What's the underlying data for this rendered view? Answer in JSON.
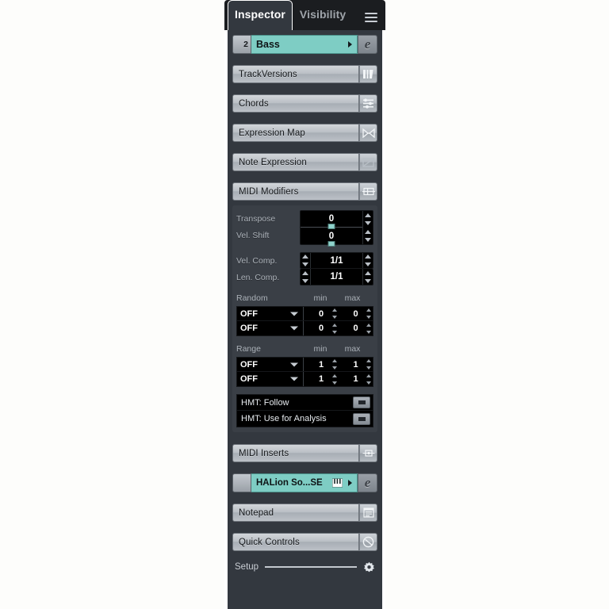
{
  "window": {
    "tabs": [
      {
        "label": "Inspector",
        "active": true
      },
      {
        "label": "Visibility",
        "active": false
      }
    ],
    "menu_icon": "hamburger-icon"
  },
  "track": {
    "number": "2",
    "name": "Bass",
    "color": "#7ecdc4",
    "edit_button": "e",
    "expand_icon": "caret-right-icon"
  },
  "sections": [
    {
      "label": "TrackVersions",
      "icon": "track-versions-icon"
    },
    {
      "label": "Chords",
      "icon": "chords-icon"
    },
    {
      "label": "Expression Map",
      "icon": "expression-map-icon"
    },
    {
      "label": "Note Expression",
      "icon": "note-expression-icon"
    },
    {
      "label": "MIDI Modifiers",
      "icon": "midi-modifiers-icon"
    }
  ],
  "midi_modifiers": {
    "sliders": [
      {
        "label": "Transpose",
        "value": "0"
      },
      {
        "label": "Vel. Shift",
        "value": "0"
      }
    ],
    "compressors": [
      {
        "label": "Vel. Comp.",
        "value": "1/1"
      },
      {
        "label": "Len. Comp.",
        "value": "1/1"
      }
    ],
    "random": {
      "title": "Random",
      "col_min": "min",
      "col_max": "max",
      "rows": [
        {
          "target": "OFF",
          "min": "0",
          "max": "0"
        },
        {
          "target": "OFF",
          "min": "0",
          "max": "0"
        }
      ]
    },
    "range": {
      "title": "Range",
      "col_min": "min",
      "col_max": "max",
      "rows": [
        {
          "target": "OFF",
          "min": "1",
          "max": "1"
        },
        {
          "target": "OFF",
          "min": "1",
          "max": "1"
        }
      ]
    },
    "hmt": [
      {
        "label": "HMT: Follow",
        "state": "off"
      },
      {
        "label": "HMT: Use for Analysis",
        "state": "off"
      }
    ]
  },
  "midi_inserts": {
    "label": "MIDI Inserts",
    "icon": "midi-inserts-icon"
  },
  "instrument": {
    "name": "HALion So...SE",
    "color": "#7ecdc4",
    "keyboard_icon": "piano-keyboard-icon",
    "expand_icon": "caret-right-icon",
    "edit_button": "e"
  },
  "notepad": {
    "label": "Notepad",
    "icon": "notepad-icon"
  },
  "quick_controls": {
    "label": "Quick Controls",
    "icon": "quick-controls-icon"
  },
  "setup": {
    "label": "Setup",
    "icon": "gear-icon"
  },
  "colors": {
    "panel_bg": "#33383f",
    "block_bg": "#3a3f46",
    "field_bg": "#000000",
    "accent_teal": "#7ecdc4",
    "tabbar_bg": "#1b1d20",
    "button_light": "#b9bec4"
  }
}
